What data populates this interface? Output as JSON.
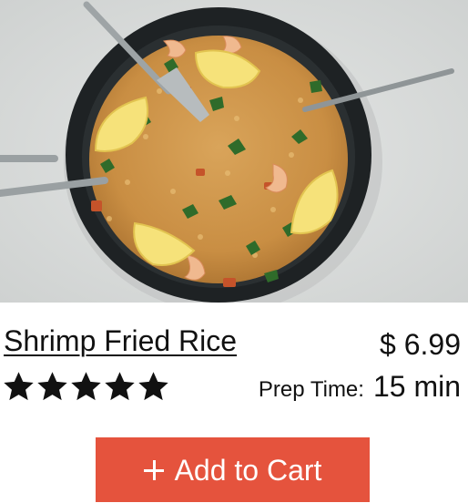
{
  "product": {
    "title": "Shrimp Fried Rice",
    "price": "$ 6.99",
    "rating": 5,
    "rating_max": 5,
    "prep_label": "Prep Time:",
    "prep_value": "15 min"
  },
  "cart_button": {
    "label": "Add to Cart",
    "icon": "plus-icon",
    "color": "#e5533d"
  },
  "image": {
    "subject": "food-photo-shrimp-fried-rice"
  }
}
